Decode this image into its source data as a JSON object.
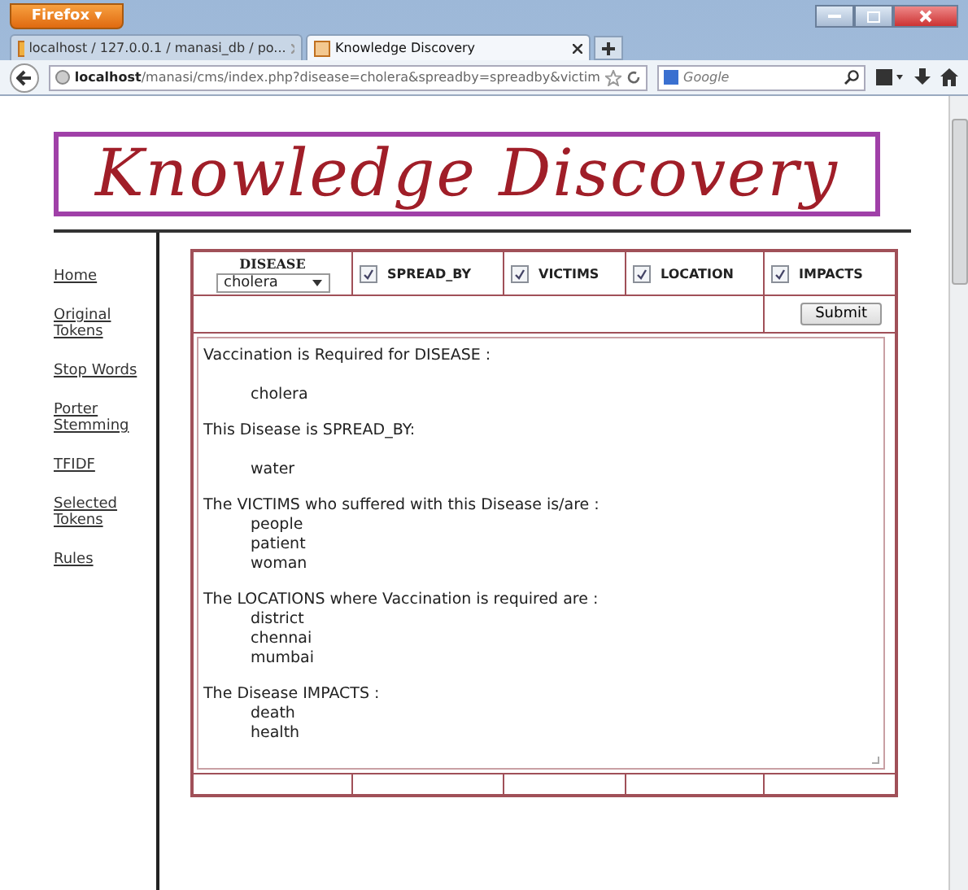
{
  "browser": {
    "menu_button": "Firefox ▾",
    "tabs": [
      {
        "label": "localhost / 127.0.0.1 / manasi_db / po...",
        "selected": false
      },
      {
        "label": "Knowledge Discovery",
        "selected": true
      }
    ],
    "url_host": "localhost",
    "url_rest": "/manasi/cms/index.php?disease=cholera&spreadby=spreadby&victim",
    "search": {
      "placeholder": "Google"
    }
  },
  "header": {
    "title": "Knowledge Discovery"
  },
  "sidebar": {
    "items": [
      {
        "label": "Home"
      },
      {
        "label": "Original Tokens"
      },
      {
        "label": "Stop Words"
      },
      {
        "label": "Porter Stemming"
      },
      {
        "label": "TFIDF"
      },
      {
        "label": "Selected Tokens"
      },
      {
        "label": "Rules"
      }
    ]
  },
  "form": {
    "disease": {
      "label": "DISEASE",
      "value": "cholera"
    },
    "options": [
      {
        "label": "SPREAD_BY",
        "checked": true
      },
      {
        "label": "VICTIMS",
        "checked": true
      },
      {
        "label": "LOCATION",
        "checked": true
      },
      {
        "label": "IMPACTS",
        "checked": true
      }
    ],
    "submit": "Submit"
  },
  "results": [
    {
      "heading": "Vaccination is Required for DISEASE :",
      "spaced": true,
      "items": [
        "cholera"
      ]
    },
    {
      "heading": "This Disease is SPREAD_BY:",
      "spaced": true,
      "items": [
        "water"
      ]
    },
    {
      "heading": "The VICTIMS who suffered with this Disease is/are :",
      "spaced": false,
      "items": [
        "people",
        "patient",
        "woman"
      ]
    },
    {
      "heading": "The LOCATIONS where Vaccination is required are :",
      "spaced": false,
      "items": [
        "district",
        "chennai",
        "mumbai"
      ]
    },
    {
      "heading": "The Disease IMPACTS :",
      "spaced": false,
      "items": [
        "death",
        "health"
      ]
    }
  ]
}
